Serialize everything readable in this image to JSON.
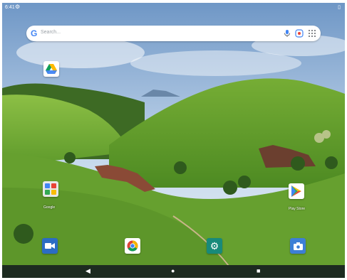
{
  "status_bar": {
    "time": "6:41",
    "settings_icon": "gear-icon",
    "battery_icon": "battery-icon"
  },
  "search": {
    "placeholder": "Search...",
    "logo_letter": "G"
  },
  "desktop": {
    "drive_icon": "google-drive-icon",
    "google_folder_label": "Google",
    "play_store_label": "Play Store"
  },
  "dock": [
    "camera-icon",
    "chrome-icon",
    "settings-icon",
    "camera-app-icon"
  ],
  "nav": {
    "back": "◀",
    "home": "●",
    "recents": "■"
  },
  "colors": {
    "nav_bar": "#1d2b20",
    "search_bg": "#ffffff",
    "sky": "#7fa5cf",
    "grass": "#5f9a2a"
  }
}
